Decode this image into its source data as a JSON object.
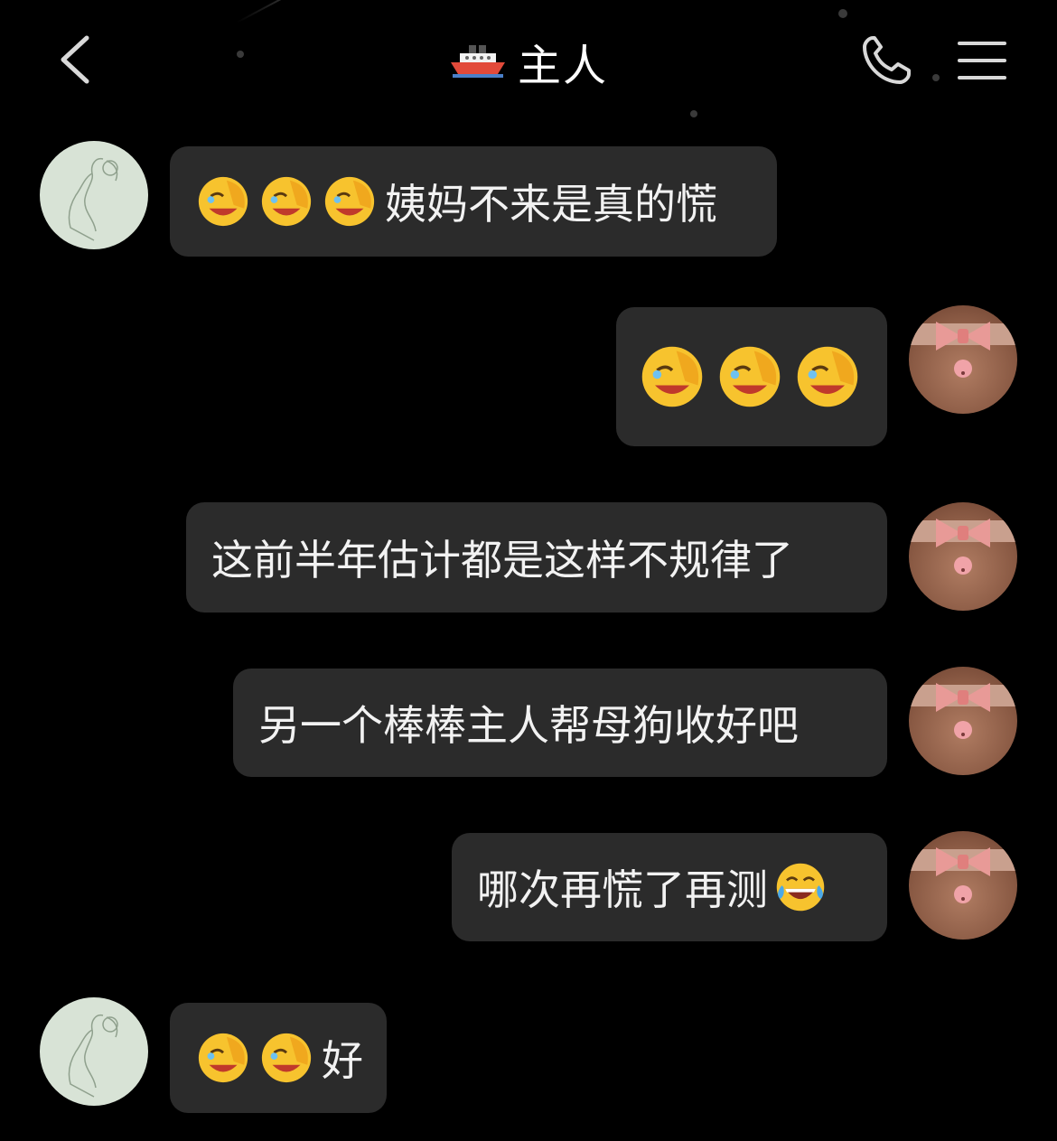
{
  "header": {
    "title": "主人",
    "back_icon": "chevron-left-icon",
    "title_icon": "ship-icon",
    "call_icon": "phone-icon",
    "menu_icon": "hamburger-menu-icon"
  },
  "colors": {
    "background": "#000000",
    "bubble": "#2b2b2b",
    "text": "#f2f2f2"
  },
  "messages": [
    {
      "sender": "other",
      "emojis": [
        "facepalm-cry-emoji",
        "facepalm-cry-emoji",
        "facepalm-cry-emoji"
      ],
      "text": "姨妈不来是真的慌"
    },
    {
      "sender": "me",
      "emojis": [
        "facepalm-cry-emoji",
        "facepalm-cry-emoji",
        "facepalm-cry-emoji"
      ],
      "text": ""
    },
    {
      "sender": "me",
      "emojis": [],
      "text": "这前半年估计都是这样不规律了"
    },
    {
      "sender": "me",
      "emojis": [],
      "text": "另一个棒棒主人帮母狗收好吧"
    },
    {
      "sender": "me",
      "emojis": [],
      "text": "哪次再慌了再测",
      "trailing_emoji": "tears-of-joy-emoji"
    },
    {
      "sender": "other",
      "emojis": [
        "facepalm-cry-emoji",
        "facepalm-cry-emoji"
      ],
      "text": "好"
    }
  ]
}
